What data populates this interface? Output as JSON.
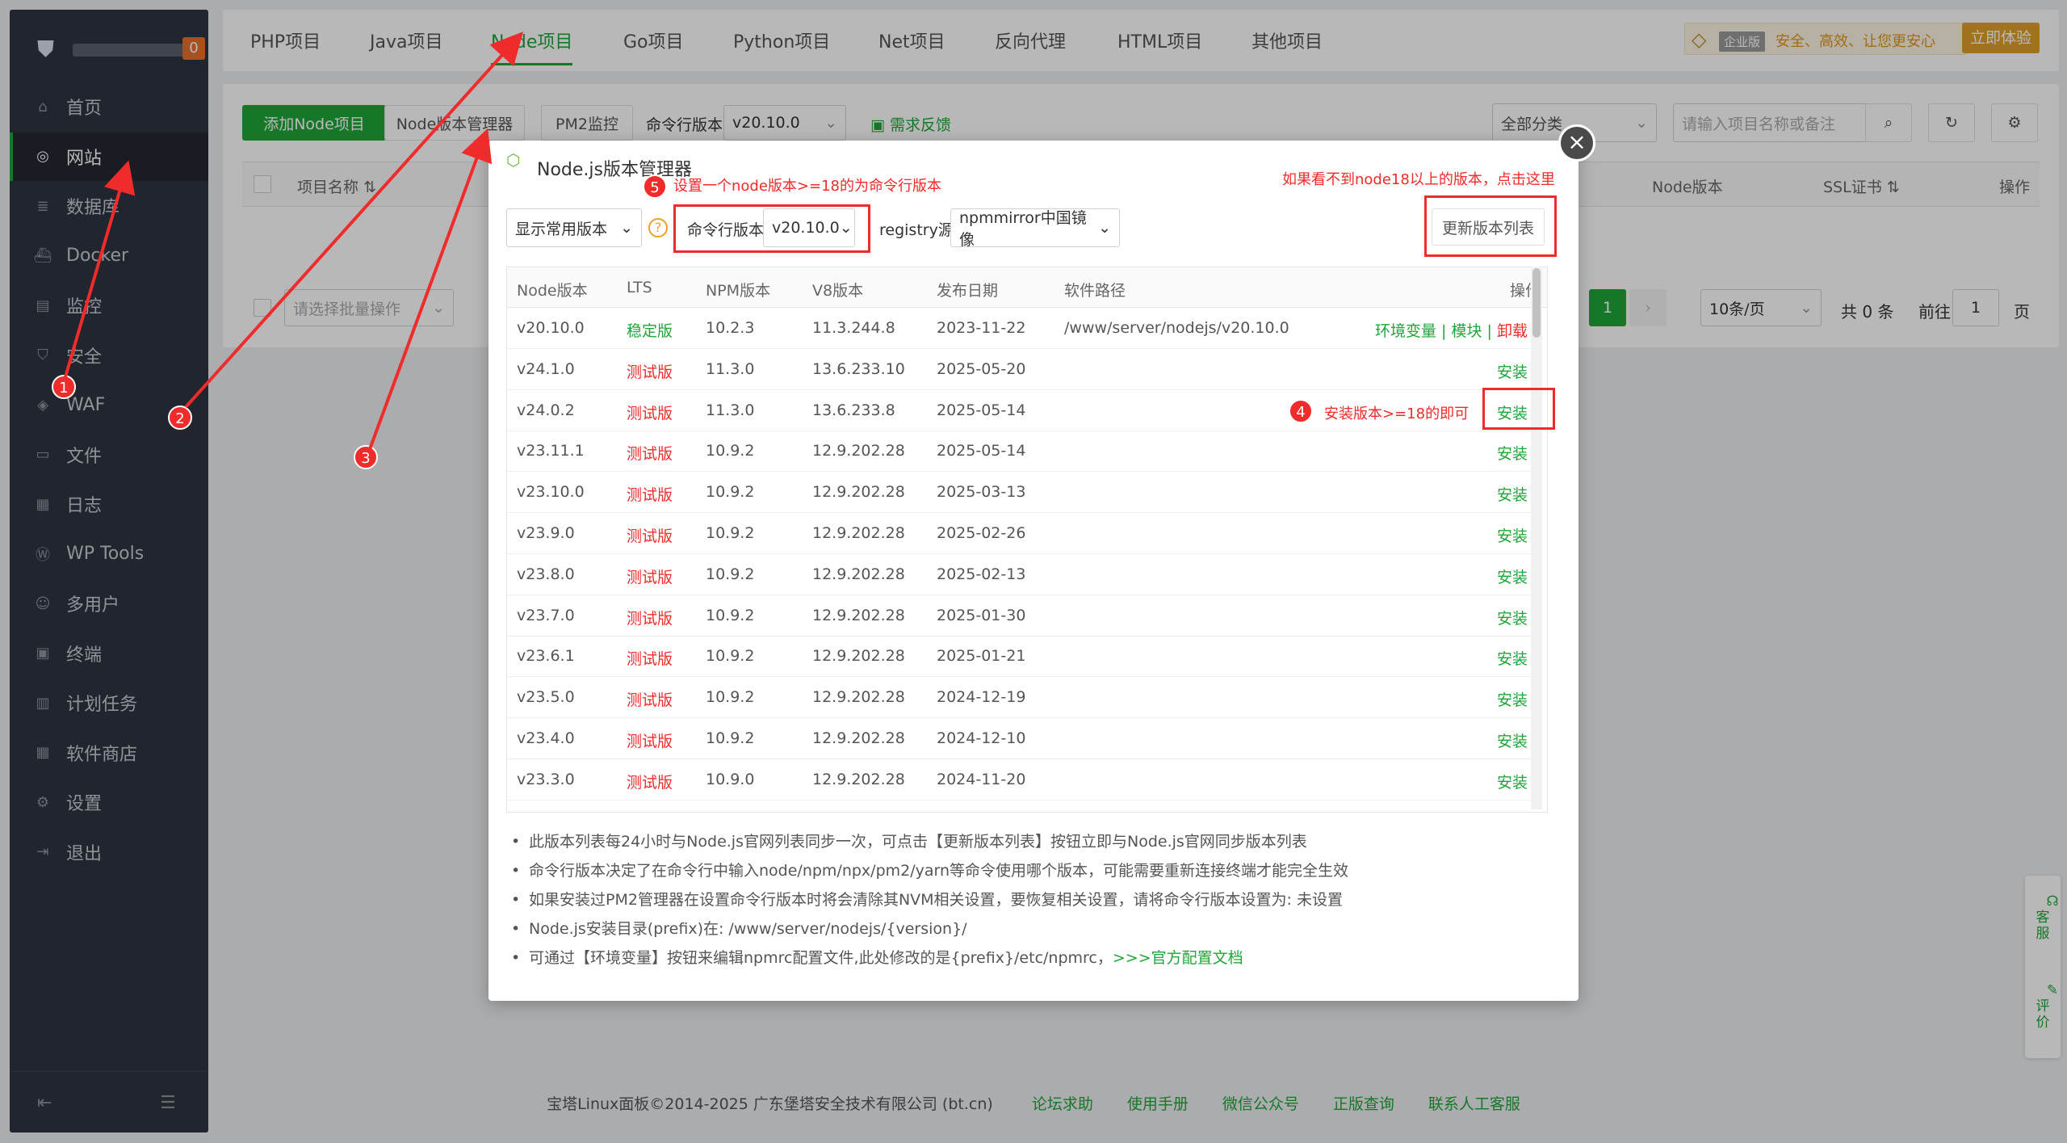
{
  "sidebar": {
    "badge": "0",
    "items": [
      {
        "label": "首页",
        "icon": "home-icon"
      },
      {
        "label": "网站",
        "icon": "globe-icon"
      },
      {
        "label": "数据库",
        "icon": "database-icon"
      },
      {
        "label": "Docker",
        "icon": "docker-icon"
      },
      {
        "label": "监控",
        "icon": "monitor-icon"
      },
      {
        "label": "安全",
        "icon": "shield-icon"
      },
      {
        "label": "WAF",
        "icon": "waf-icon"
      },
      {
        "label": "文件",
        "icon": "folder-icon"
      },
      {
        "label": "日志",
        "icon": "log-icon"
      },
      {
        "label": "WP Tools",
        "icon": "wordpress-icon"
      },
      {
        "label": "多用户",
        "icon": "users-icon"
      },
      {
        "label": "终端",
        "icon": "terminal-icon"
      },
      {
        "label": "计划任务",
        "icon": "calendar-icon"
      },
      {
        "label": "软件商店",
        "icon": "grid-icon"
      },
      {
        "label": "设置",
        "icon": "gear-icon"
      },
      {
        "label": "退出",
        "icon": "logout-icon"
      }
    ]
  },
  "topnav": {
    "tabs": [
      "PHP项目",
      "Java项目",
      "Node项目",
      "Go项目",
      "Python项目",
      "Net项目",
      "反向代理",
      "HTML项目",
      "其他项目"
    ],
    "enterprise_label": "企业版",
    "enterprise_slogan": "安全、高效、让您更安心",
    "try_button": "立即体验"
  },
  "toolbar": {
    "add_button": "添加Node项目",
    "version_manager_button": "Node版本管理器",
    "pm2_button": "PM2监控",
    "cmd_version_label": "命令行版本",
    "cmd_version_value": "v20.10.0",
    "feedback": "需求反馈",
    "category": "全部分类",
    "search_placeholder": "请输入项目名称或备注"
  },
  "list": {
    "col_name": "项目名称",
    "col_node": "Node版本",
    "col_ssl": "SSL证书",
    "col_ops": "操作",
    "batch_placeholder": "请选择批量操作",
    "page_current": "1",
    "page_size": "10条/页",
    "total": "共 0 条",
    "goto": "前往",
    "page_input": "1",
    "page_suffix": "页"
  },
  "modal": {
    "title": "Node.js版本管理器",
    "show_select": "显示常用版本",
    "cmd_version_label": "命令行版本",
    "cmd_version_value": "v20.10.0",
    "registry_label": "registry源",
    "registry_value": "npmmirror中国镜像",
    "update_button": "更新版本列表",
    "columns": [
      "Node版本",
      "LTS",
      "NPM版本",
      "V8版本",
      "发布日期",
      "软件路径",
      "操作"
    ],
    "rows": [
      {
        "version": "v20.10.0",
        "lts": "稳定版",
        "npm": "10.2.3",
        "v8": "11.3.244.8",
        "date": "2023-11-22",
        "path": "/www/server/nodejs/v20.10.0",
        "installed": true
      },
      {
        "version": "v24.1.0",
        "lts": "测试版",
        "npm": "11.3.0",
        "v8": "13.6.233.10",
        "date": "2025-05-20",
        "path": "",
        "installed": false
      },
      {
        "version": "v24.0.2",
        "lts": "测试版",
        "npm": "11.3.0",
        "v8": "13.6.233.8",
        "date": "2025-05-14",
        "path": "",
        "installed": false
      },
      {
        "version": "v23.11.1",
        "lts": "测试版",
        "npm": "10.9.2",
        "v8": "12.9.202.28",
        "date": "2025-05-14",
        "path": "",
        "installed": false
      },
      {
        "version": "v23.10.0",
        "lts": "测试版",
        "npm": "10.9.2",
        "v8": "12.9.202.28",
        "date": "2025-03-13",
        "path": "",
        "installed": false
      },
      {
        "version": "v23.9.0",
        "lts": "测试版",
        "npm": "10.9.2",
        "v8": "12.9.202.28",
        "date": "2025-02-26",
        "path": "",
        "installed": false
      },
      {
        "version": "v23.8.0",
        "lts": "测试版",
        "npm": "10.9.2",
        "v8": "12.9.202.28",
        "date": "2025-02-13",
        "path": "",
        "installed": false
      },
      {
        "version": "v23.7.0",
        "lts": "测试版",
        "npm": "10.9.2",
        "v8": "12.9.202.28",
        "date": "2025-01-30",
        "path": "",
        "installed": false
      },
      {
        "version": "v23.6.1",
        "lts": "测试版",
        "npm": "10.9.2",
        "v8": "12.9.202.28",
        "date": "2025-01-21",
        "path": "",
        "installed": false
      },
      {
        "version": "v23.5.0",
        "lts": "测试版",
        "npm": "10.9.2",
        "v8": "12.9.202.28",
        "date": "2024-12-19",
        "path": "",
        "installed": false
      },
      {
        "version": "v23.4.0",
        "lts": "测试版",
        "npm": "10.9.2",
        "v8": "12.9.202.28",
        "date": "2024-12-10",
        "path": "",
        "installed": false
      },
      {
        "version": "v23.3.0",
        "lts": "测试版",
        "npm": "10.9.0",
        "v8": "12.9.202.28",
        "date": "2024-11-20",
        "path": "",
        "installed": false
      }
    ],
    "action_env": "环境变量",
    "action_module": "模块",
    "action_uninstall": "卸载",
    "action_install": "安装",
    "notes": [
      "此版本列表每24小时与Node.js官网列表同步一次，可点击【更新版本列表】按钮立即与Node.js官网同步版本列表",
      "命令行版本决定了在命令行中输入node/npm/npx/pm2/yarn等命令使用哪个版本，可能需要重新连接终端才能完全生效",
      "如果安装过PM2管理器在设置命令行版本时将会清除其NVM相关设置，要恢复相关设置，请将命令行版本设置为: 未设置",
      "Node.js安装目录(prefix)在: /www/server/nodejs/{version}/",
      "可通过【环境变量】按钮来编辑npmrc配置文件,此处修改的是{prefix}/etc/npmrc，"
    ],
    "notes_link": ">>>官方配置文档"
  },
  "annotations": {
    "n1": "1",
    "n2": "2",
    "n3": "3",
    "n4": "4",
    "n5": "5",
    "text4": "安装版本>=18的即可",
    "text5": "设置一个node版本>=18的为命令行版本",
    "text_top_right": "如果看不到node18以上的版本，点击这里",
    "color": "#f02b2b"
  },
  "footer": {
    "copyright": "宝塔Linux面板©2014-2025 广东堡塔安全技术有限公司 (bt.cn)",
    "links": [
      "论坛求助",
      "使用手册",
      "微信公众号",
      "正版查询",
      "联系人工客服"
    ]
  },
  "float": {
    "service": "客服",
    "review": "评价"
  }
}
